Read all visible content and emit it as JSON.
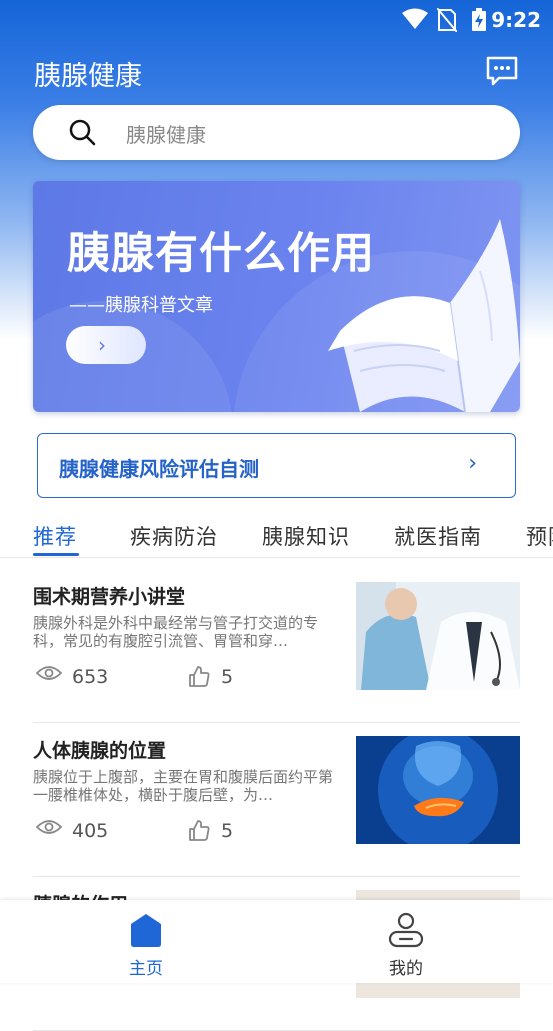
{
  "status": {
    "time": "9:22"
  },
  "app": {
    "title": "胰腺健康"
  },
  "search": {
    "placeholder": "胰腺健康"
  },
  "banner": {
    "title": "胰腺有什么作用",
    "subtitle": "——胰腺科普文章",
    "button": "›"
  },
  "assessment": {
    "label": "胰腺健康风险评估自测",
    "arrow": "›"
  },
  "tabs": [
    {
      "label": "推荐",
      "active": true
    },
    {
      "label": "疾病防治"
    },
    {
      "label": "胰腺知识"
    },
    {
      "label": "就医指南"
    },
    {
      "label": "预防"
    }
  ],
  "articles": [
    {
      "title": "围术期营养小讲堂",
      "summary": "胰腺外科是外科中最经常与管子打交道的专科，常见的有腹腔引流管、胃管和穿…",
      "views": "653",
      "likes": "5"
    },
    {
      "title": "人体胰腺的位置",
      "summary": "胰腺位于上腹部，主要在胃和腹膜后面约平第一腰椎椎体处，横卧于腹后壁，为…",
      "views": "405",
      "likes": "5"
    },
    {
      "title": "胰腺的作用"
    }
  ],
  "nav": {
    "home": "主页",
    "mine": "我的"
  },
  "colors": {
    "primary": "#1f66d6",
    "banner": "#6b83ee",
    "header": "#1565d8"
  }
}
